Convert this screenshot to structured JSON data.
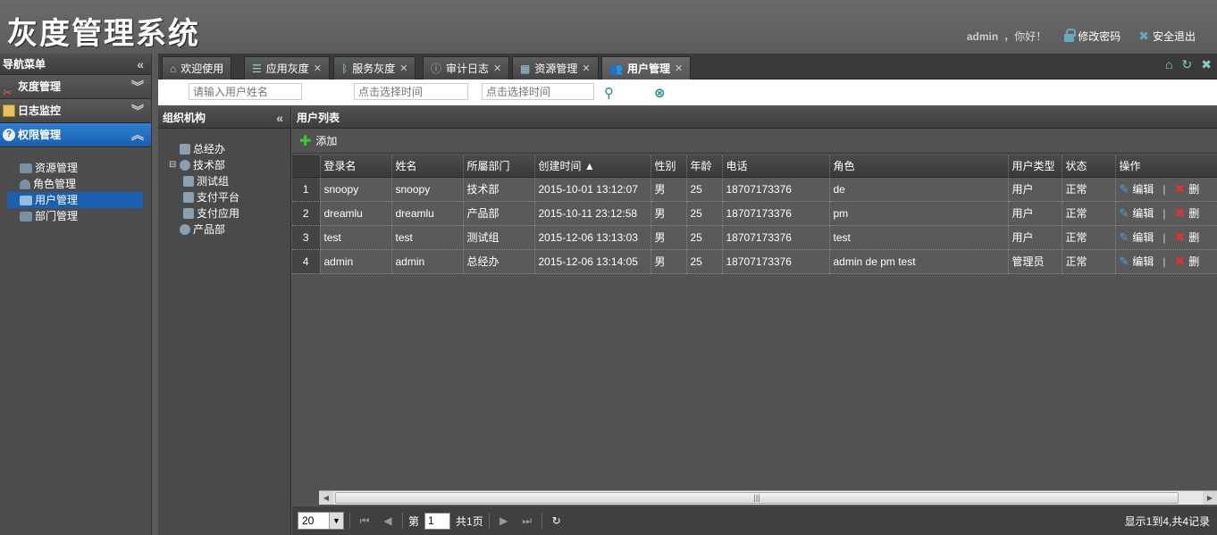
{
  "app": {
    "title": "灰度管理系统"
  },
  "user": {
    "name": "admin",
    "greeting": "，你好！",
    "change_password": "修改密码",
    "logout": "安全退出"
  },
  "nav": {
    "title": "导航菜单",
    "groups": [
      {
        "label": "灰度管理"
      },
      {
        "label": "日志监控"
      },
      {
        "label": "权限管理"
      }
    ],
    "items": [
      {
        "label": "资源管理"
      },
      {
        "label": "角色管理"
      },
      {
        "label": "用户管理"
      },
      {
        "label": "部门管理"
      }
    ]
  },
  "tabs": [
    {
      "label": "欢迎使用"
    },
    {
      "label": "应用灰度"
    },
    {
      "label": "服务灰度"
    },
    {
      "label": "审计日志"
    },
    {
      "label": "资源管理"
    },
    {
      "label": "用户管理"
    }
  ],
  "search": {
    "name_placeholder": "请输入用户姓名",
    "start_placeholder": "点击选择时间",
    "end_placeholder": "点击选择时间"
  },
  "org": {
    "title": "组织机构",
    "nodes": [
      {
        "label": "总经办"
      },
      {
        "label": "技术部"
      },
      {
        "label": "测试组"
      },
      {
        "label": "支付平台"
      },
      {
        "label": "支付应用"
      },
      {
        "label": "产品部"
      }
    ]
  },
  "list": {
    "title": "用户列表",
    "add_label": "添加",
    "columns": [
      "登录名",
      "姓名",
      "所屬部门",
      "创建时间 ▲",
      "性别",
      "年龄",
      "电话",
      "角色",
      "用户类型",
      "状态",
      "操作"
    ],
    "edit_label": "编辑",
    "delete_label": "删",
    "rows": [
      {
        "num": "1",
        "login": "snoopy",
        "name": "snoopy",
        "dept": "技术部",
        "created": "2015-10-01 13:12:07",
        "sex": "男",
        "age": "25",
        "phone": "18707173376",
        "role": "de",
        "type": "用户",
        "status": "正常"
      },
      {
        "num": "2",
        "login": "dreamlu",
        "name": "dreamlu",
        "dept": "产品部",
        "created": "2015-10-11 23:12:58",
        "sex": "男",
        "age": "25",
        "phone": "18707173376",
        "role": "pm",
        "type": "用户",
        "status": "正常"
      },
      {
        "num": "3",
        "login": "test",
        "name": "test",
        "dept": "测试组",
        "created": "2015-12-06 13:13:03",
        "sex": "男",
        "age": "25",
        "phone": "18707173376",
        "role": "test",
        "type": "用户",
        "status": "正常"
      },
      {
        "num": "4",
        "login": "admin",
        "name": "admin",
        "dept": "总经办",
        "created": "2015-12-06 13:14:05",
        "sex": "男",
        "age": "25",
        "phone": "18707173376",
        "role": "admin de pm test",
        "type": "管理员",
        "status": "正常"
      }
    ]
  },
  "pager": {
    "page_size": "20",
    "page_prefix": "第",
    "page": "1",
    "page_suffix": "共1页",
    "info": "显示1到4,共4记录"
  }
}
